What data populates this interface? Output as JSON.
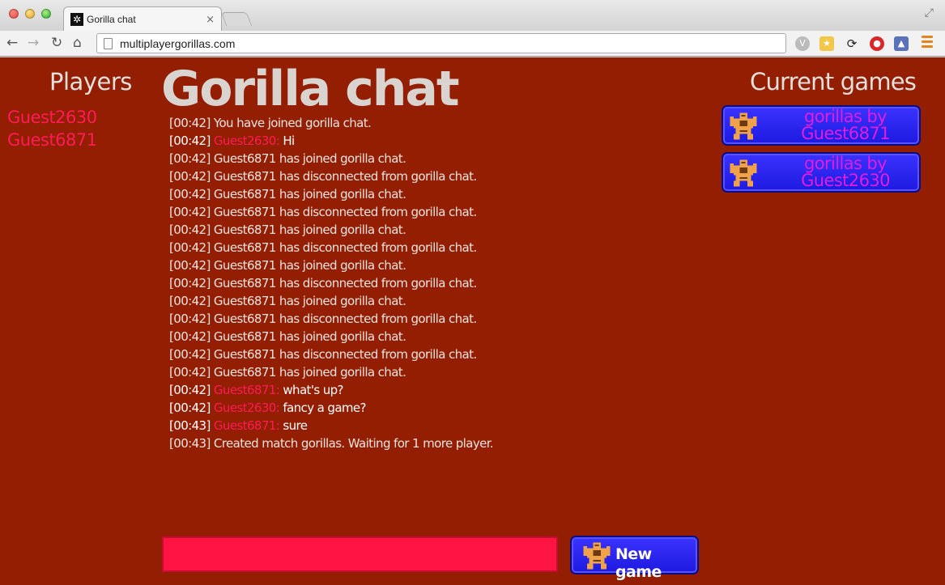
{
  "browser": {
    "tab_title": "Gorilla chat",
    "tab_close": "×",
    "url": "multiplayergorillas.com",
    "icons": {
      "back": "arrow-left-icon",
      "forward": "arrow-right-icon",
      "reload": "reload-icon",
      "home": "home-icon",
      "menu": "hamburger-menu-icon"
    }
  },
  "sidebar": {
    "title": "Players",
    "players": [
      "Guest2630",
      "Guest6871"
    ]
  },
  "main": {
    "title": "Gorilla chat",
    "messages": [
      {
        "time": "[00:42]",
        "user": "",
        "text": "You have joined gorilla chat."
      },
      {
        "time": "[00:42]",
        "user": "Guest2630:",
        "text": "Hi"
      },
      {
        "time": "[00:42]",
        "user": "",
        "text": "Guest6871 has joined gorilla chat."
      },
      {
        "time": "[00:42]",
        "user": "",
        "text": "Guest6871 has disconnected from gorilla chat."
      },
      {
        "time": "[00:42]",
        "user": "",
        "text": "Guest6871 has joined gorilla chat."
      },
      {
        "time": "[00:42]",
        "user": "",
        "text": "Guest6871 has disconnected from gorilla chat."
      },
      {
        "time": "[00:42]",
        "user": "",
        "text": "Guest6871 has joined gorilla chat."
      },
      {
        "time": "[00:42]",
        "user": "",
        "text": "Guest6871 has disconnected from gorilla chat."
      },
      {
        "time": "[00:42]",
        "user": "",
        "text": "Guest6871 has joined gorilla chat."
      },
      {
        "time": "[00:42]",
        "user": "",
        "text": "Guest6871 has disconnected from gorilla chat."
      },
      {
        "time": "[00:42]",
        "user": "",
        "text": "Guest6871 has joined gorilla chat."
      },
      {
        "time": "[00:42]",
        "user": "",
        "text": "Guest6871 has disconnected from gorilla chat."
      },
      {
        "time": "[00:42]",
        "user": "",
        "text": "Guest6871 has joined gorilla chat."
      },
      {
        "time": "[00:42]",
        "user": "",
        "text": "Guest6871 has disconnected from gorilla chat."
      },
      {
        "time": "[00:42]",
        "user": "",
        "text": "Guest6871 has joined gorilla chat."
      },
      {
        "time": "[00:42]",
        "user": "Guest6871:",
        "text": "what's up?"
      },
      {
        "time": "[00:42]",
        "user": "Guest2630:",
        "text": "fancy a game?"
      },
      {
        "time": "[00:43]",
        "user": "Guest6871:",
        "text": "sure"
      },
      {
        "time": "[00:43]",
        "user": "",
        "text": "Created match gorillas. Waiting for 1 more player."
      }
    ],
    "input_value": "",
    "new_game_label": "New game",
    "new_game_icon": "gorilla-icon"
  },
  "games": {
    "title": "Current games",
    "items": [
      {
        "label": "gorillas by Guest6871",
        "icon": "gorilla-icon"
      },
      {
        "label": "gorillas by Guest2630",
        "icon": "gorilla-icon"
      }
    ]
  },
  "colors": {
    "page_background": "#931e02",
    "username": "#ff1b55",
    "button_blue": "#2a22f5",
    "game_label": "#e41cde",
    "chat_input": "#ff1444"
  }
}
